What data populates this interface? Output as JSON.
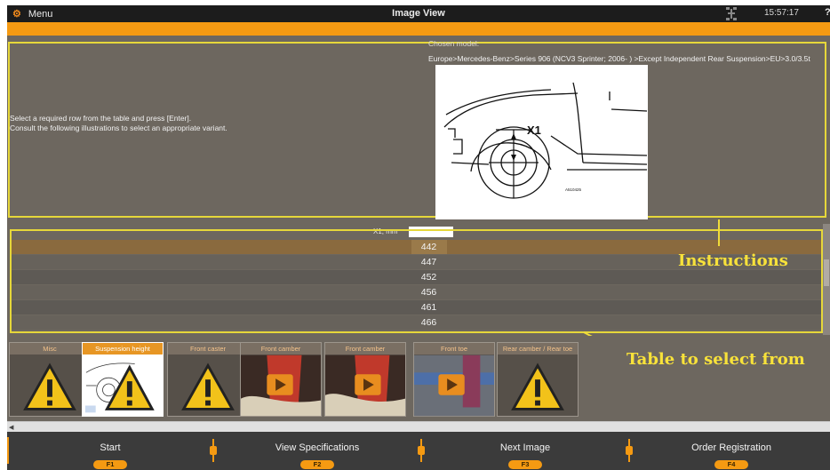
{
  "titlebar": {
    "menu_label": "Menu",
    "title": "Image View",
    "time": "15:57:17",
    "help": "?"
  },
  "instructions": {
    "line1": "Select a required row from the table and press [Enter].",
    "line2": "Consult the following illustrations to select an appropriate variant."
  },
  "chosen_model": {
    "label": "Chosen model:",
    "path": "Europe>Mercedes-Benz>Series 906 (NCV3 Sprinter; 2006- ) >Except Independent Rear Suspension>EU>3.0/3.5t"
  },
  "illustration": {
    "dimension_label": "X1",
    "code": "A510425"
  },
  "table": {
    "header": "X1, mm",
    "rows": [
      "442",
      "447",
      "452",
      "456",
      "461",
      "466"
    ],
    "selected_index": 0
  },
  "annotations": {
    "instructions": "Instructions",
    "table": "Table to select from"
  },
  "thumbnails": [
    {
      "label": "Misc",
      "icon": "warning-icon",
      "active": false
    },
    {
      "label": "Suspension height",
      "icon": "warning-icon",
      "active": true
    },
    {
      "label": "Front caster",
      "icon": "warning-icon",
      "active": false
    },
    {
      "label": "Front camber",
      "icon": "play-icon",
      "active": false
    },
    {
      "label": "Front camber",
      "icon": "play-icon",
      "active": false
    },
    {
      "label": "Front toe",
      "icon": "play-icon",
      "active": false
    },
    {
      "label": "Rear camber / Rear toe",
      "icon": "warning-icon",
      "active": false
    }
  ],
  "function_keys": [
    {
      "label": "Start",
      "key": "F1"
    },
    {
      "label": "View Specifications",
      "key": "F2"
    },
    {
      "label": "Next Image",
      "key": "F3"
    },
    {
      "label": "Order Registration",
      "key": "F4"
    }
  ],
  "colors": {
    "accent": "#f59a12",
    "highlight": "#e6d73a",
    "panel": "#6d675f"
  }
}
